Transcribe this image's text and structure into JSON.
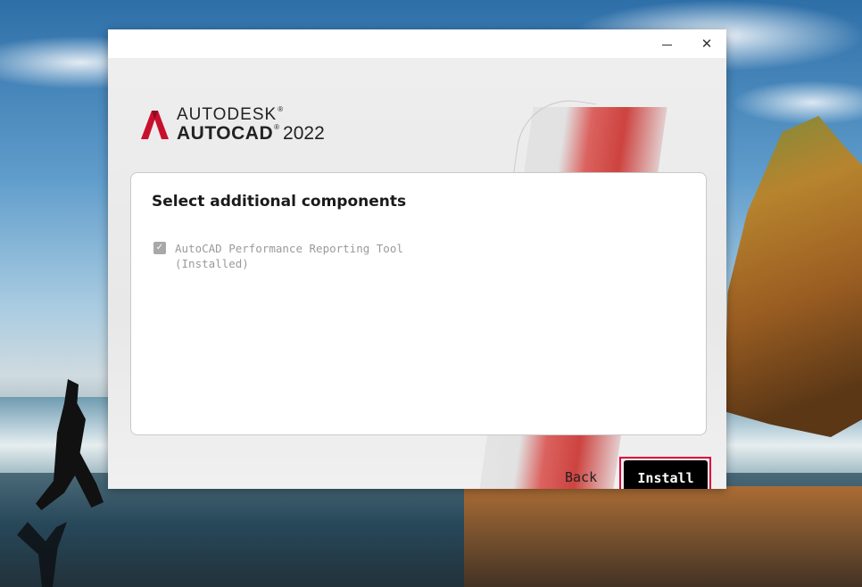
{
  "window": {
    "minimize_label": "–",
    "close_label": "✕"
  },
  "brand": {
    "company": "AUTODESK",
    "product": "AUTOCAD",
    "year": "2022",
    "trademark": "®",
    "logo_color": "#c8102e"
  },
  "panel": {
    "title": "Select additional components",
    "components": [
      {
        "label_line1": "AutoCAD Performance Reporting Tool",
        "label_line2": "(Installed)",
        "checked": true,
        "disabled": true
      }
    ]
  },
  "footer": {
    "back_label": "Back",
    "install_label": "Install"
  },
  "colors": {
    "install_bg": "#000000",
    "highlight": "#e0003c"
  }
}
